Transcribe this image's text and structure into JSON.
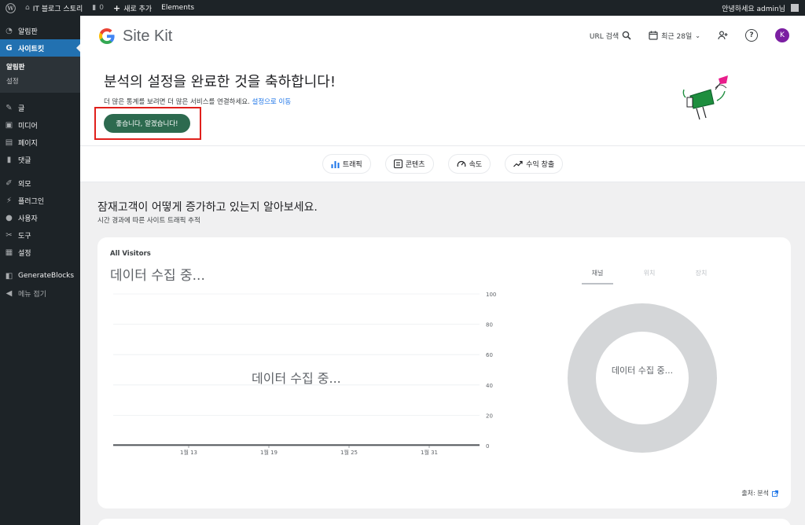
{
  "adminbar": {
    "site_name": "IT 블로그 스토리",
    "comments_count": "0",
    "new_label": "새로 추가",
    "elements_label": "Elements",
    "greeting": "안녕하세요 admin님"
  },
  "sidebar": {
    "items": [
      {
        "label": "알림판",
        "icon": "dashboard-icon"
      },
      {
        "label": "사이트킷",
        "icon": "google-g-icon"
      }
    ],
    "sub_items": [
      "알림판",
      "설정"
    ],
    "items2": [
      {
        "label": "글",
        "icon": "pin-icon"
      },
      {
        "label": "미디어",
        "icon": "media-icon"
      },
      {
        "label": "페이지",
        "icon": "page-icon"
      },
      {
        "label": "댓글",
        "icon": "comment-icon"
      }
    ],
    "items3": [
      {
        "label": "외모",
        "icon": "brush-icon"
      },
      {
        "label": "플러그인",
        "icon": "plugin-icon"
      },
      {
        "label": "사용자",
        "icon": "users-icon"
      },
      {
        "label": "도구",
        "icon": "wrench-icon"
      },
      {
        "label": "설정",
        "icon": "settings-icon"
      }
    ],
    "items4": [
      {
        "label": "GenerateBlocks",
        "icon": "blocks-icon"
      },
      {
        "label": "메뉴 접기",
        "icon": "collapse-icon"
      }
    ]
  },
  "header": {
    "logo_title": "Site Kit",
    "url_search": "URL 검색",
    "date_range": "최근 28일",
    "user_initial": "K"
  },
  "banner": {
    "title": "분석의 설정을 완료한 것을 축하합니다!",
    "desc": "더 많은 통계를 보려면 더 많은 서비스를 연결하세요.",
    "link": "설정으로 이동",
    "cta": "좋습니다, 알겠습니다!"
  },
  "chips": [
    "트래픽",
    "콘텐츠",
    "속도",
    "수익 창출"
  ],
  "section": {
    "title": "잠재고객이 어떻게 증가하고 있는지 알아보세요.",
    "subtitle": "시간 경과에 따른 사이트 트래픽 추적"
  },
  "card": {
    "caption": "All Visitors",
    "gathering": "데이터 수집 중...",
    "chart_overlay": "데이터 수집 중...",
    "tabs": [
      "채널",
      "위치",
      "장치"
    ],
    "donut_label": "데이터 수집 중...",
    "source": "출처: 분석"
  },
  "chart_data": {
    "type": "line",
    "title": "",
    "xlabel": "",
    "ylabel": "",
    "x_ticks": [
      "1월 13",
      "1월 19",
      "1월 25",
      "1월 31"
    ],
    "y_ticks": [
      0,
      20,
      40,
      60,
      80,
      100
    ],
    "ylim": [
      0,
      100
    ],
    "grid": true,
    "series": [
      {
        "values": [
          0,
          0,
          0,
          0,
          0
        ]
      }
    ]
  },
  "colors": {
    "admin_dark": "#1d2327",
    "wp_blue": "#2271b1",
    "cta_green": "#2d6a4f",
    "highlight_red": "#e0201c",
    "donut_gray": "#d4d6d8"
  }
}
